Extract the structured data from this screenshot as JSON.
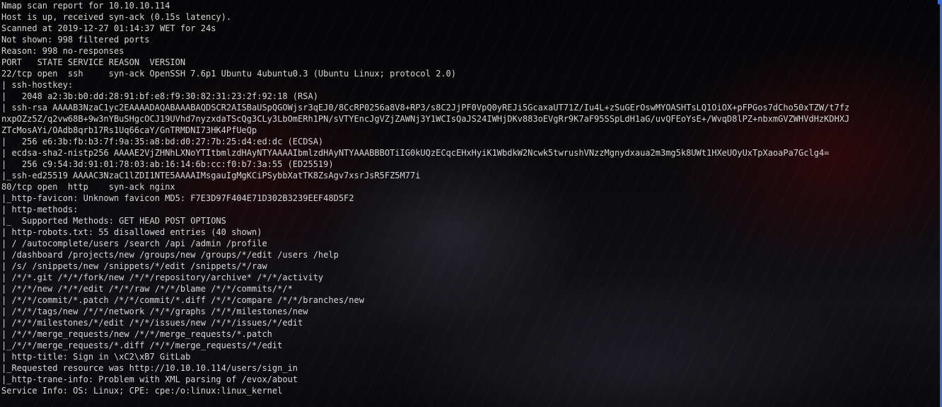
{
  "terminal": {
    "lines": [
      "Nmap scan report for 10.10.10.114",
      "Host is up, received syn-ack (0.15s latency).",
      "Scanned at 2019-12-27 01:14:37 WET for 24s",
      "Not shown: 998 filtered ports",
      "Reason: 998 no-responses",
      "PORT   STATE SERVICE REASON  VERSION",
      "22/tcp open  ssh     syn-ack OpenSSH 7.6p1 Ubuntu 4ubuntu0.3 (Ubuntu Linux; protocol 2.0)",
      "| ssh-hostkey:",
      "|   2048 a2:3b:b0:dd:28:91:bf:e8:f9:30:82:31:23:2f:92:18 (RSA)",
      "| ssh-rsa AAAAB3NzaC1yc2EAAAADAQABAAABAQDSCR2AISBaUSpQGOWjsr3qEJ0/8CcRP0256a8V8+RP3/s8C2JjPF0VpQ0yREJi5GcaxaUT71Z/Iu4L+zSuGErOswMYOASHTsLQ1OiOX+pFPGos7dCho50xTZW/t7fz",
      "nxpOZz5Z/q2vw68B+9w3nYBuSHgcOCJ19UVhd7nyzxdaTScQg3CLy3LbOmERh1PN/sVTYEncJgVZjZAWNj3Y1WCIsQaJS24IWHjDKv883oEVgRr9K7aF95SSpLdH1aG/uvQFEoYsE+/WvqD8lPZ+nbxmGVZWHVdHzKDHXJ",
      "ZTcMosAYi/OAdb8qrb17Rs1Uq66caY/GnTRMDNI73HK4PfUeQp",
      "|   256 e6:3b:fb:b3:7f:9a:35:a8:bd:d0:27:7b:25:d4:ed:dc (ECDSA)",
      "| ecdsa-sha2-nistp256 AAAAE2VjZHNhLXNoYTItbmlzdHAyNTYAAAAIbmlzdHAyNTYAAABBBOTiIG0kUQzECqcEHxHyiK1WbdkW2Ncwk5twrushVNzzMgnydxaua2m3mg5k8UWt1HXeUOyUxTpXaoaPa7Gclg4=",
      "|   256 c9:54:3d:91:01:78:03:ab:16:14:6b:cc:f0:b7:3a:55 (ED25519)",
      "|_ssh-ed25519 AAAAC3NzaC1lZDI1NTE5AAAAIMsgauIgMgKCiPSybbXatTK8ZsAgv7xsrJsR5FZ5M77i",
      "80/tcp open  http    syn-ack nginx",
      "|_http-favicon: Unknown favicon MD5: F7E3D97F404E71D302B3239EEF48D5F2",
      "| http-methods:",
      "|_  Supported Methods: GET HEAD POST OPTIONS",
      "| http-robots.txt: 55 disallowed entries (40 shown)",
      "| / /autocomplete/users /search /api /admin /profile",
      "| /dashboard /projects/new /groups/new /groups/*/edit /users /help",
      "| /s/ /snippets/new /snippets/*/edit /snippets/*/raw",
      "| /*/*.git /*/*/fork/new /*/*/repository/archive* /*/*/activity",
      "| /*/*/new /*/*/edit /*/*/raw /*/*/blame /*/*/commits/*/*",
      "| /*/*/commit/*.patch /*/*/commit/*.diff /*/*/compare /*/*/branches/new",
      "| /*/*/tags/new /*/*/network /*/*/graphs /*/*/milestones/new",
      "| /*/*/milestones/*/edit /*/*/issues/new /*/*/issues/*/edit",
      "| /*/*/merge_requests/new /*/*/merge_requests/*.patch",
      "|_/*/*/merge_requests/*.diff /*/*/merge_requests/*/edit",
      "| http-title: Sign in \\xC2\\xB7 GitLab",
      "|_Requested resource was http://10.10.10.114/users/sign_in",
      "|_http-trane-info: Problem with XML parsing of /evox/about",
      "Service Info: OS: Linux; CPE: cpe:/o:linux:linux_kernel"
    ]
  },
  "colors": {
    "text": "#d6d6d6",
    "scrollbar": "#3a6fd8"
  }
}
